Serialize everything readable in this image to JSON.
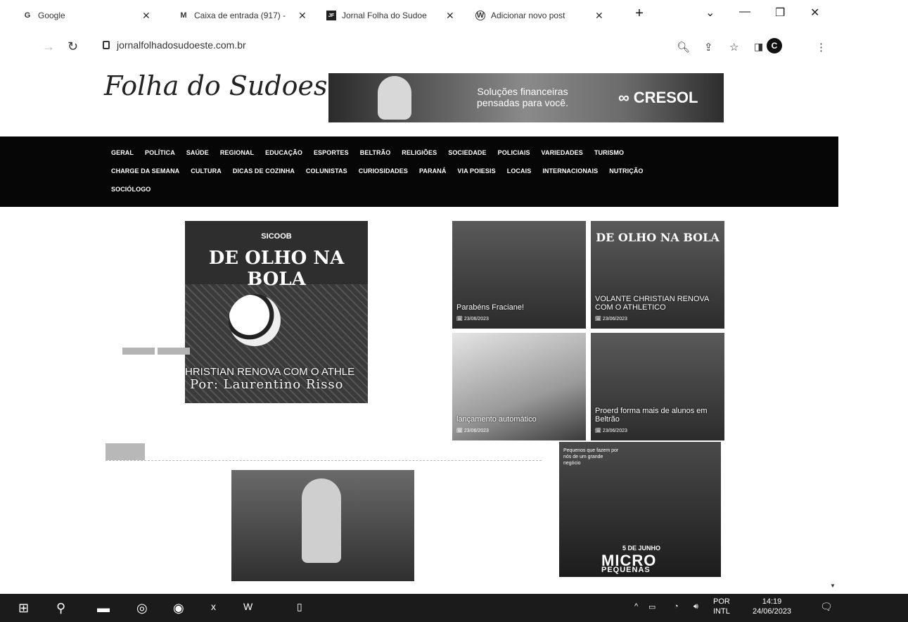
{
  "tabs": [
    {
      "icon": "G",
      "title": "Google"
    },
    {
      "icon": "M",
      "title": "Caixa de entrada (917) -"
    },
    {
      "icon": "JF",
      "title": "Jornal Folha do Sudoe"
    },
    {
      "icon": "W",
      "title": "Adicionar novo post"
    }
  ],
  "address": {
    "url": "jornalfolhadosudoeste.com.br"
  },
  "profile": {
    "initial": "C"
  },
  "site": {
    "logo": "Folha do Sudoeste"
  },
  "banner": {
    "slogan": "Soluções financeiras pensadas para você.",
    "brand": "∞ CRESOL"
  },
  "menu": {
    "row1": [
      "GERAL",
      "POLÍTICA",
      "SAÚDE",
      "REGIONAL",
      "EDUCAÇÃO",
      "ESPORTES",
      "BELTRÃO",
      "RELIGIÕES",
      "SOCIEDADE",
      "POLICIAIS",
      "VARIEDADES",
      "TURISMO"
    ],
    "row2": [
      "CHARGE DA SEMANA",
      "CULTURA",
      "DICAS DE COZINHA",
      "COLUNISTAS",
      "CURIOSIDADES",
      "PARANÁ",
      "VIA POIESIS",
      "LOCAIS",
      "INTERNACIONAIS",
      "NUTRIÇÃO"
    ],
    "row3": [
      "SOCIÓLOGO"
    ]
  },
  "hero": {
    "sponsor": "SICOOB",
    "headline": "DE OLHO NA BOLA",
    "title": "HRISTIAN RENOVA COM O ATHLE",
    "author": "Por: Laurentino Risso"
  },
  "cards": [
    {
      "title": "Parabéns Fraciane!",
      "date": "23/06/2023",
      "overlay": ""
    },
    {
      "title": "VOLANTE CHRISTIAN RENOVA COM O ATHLETICO",
      "date": "23/06/2023",
      "overlay": "DE OLHO NA BOLA"
    },
    {
      "title": "lançamento automático",
      "date": "23/06/2023",
      "overlay": ""
    },
    {
      "title": "Proerd forma mais de alunos em Beltrão",
      "date": "23/06/2023",
      "overlay": ""
    }
  ],
  "ad": {
    "promo": "Pequenos que fazem por nós de um grande negócio",
    "line1": "5 DE JUNHO",
    "line2": "MICRO",
    "line3": "PEQUENAS"
  },
  "taskbar": {
    "lang1": "POR",
    "lang2": "INTL",
    "time": "14:19",
    "date": "24/06/2023"
  }
}
